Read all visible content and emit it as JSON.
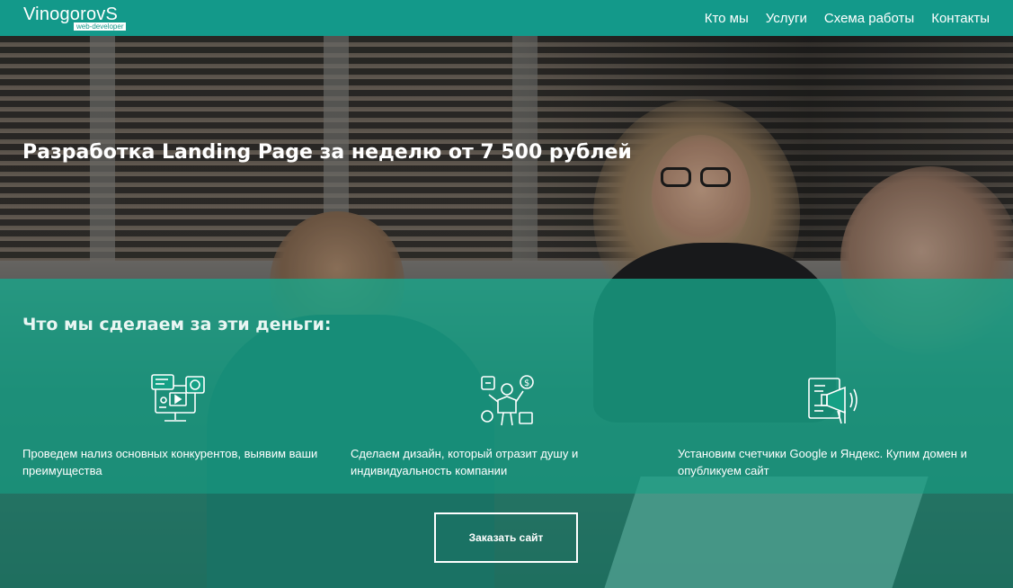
{
  "header": {
    "logo_text": "VinogorovS",
    "logo_subtitle": "web-developer",
    "nav": [
      "Кто мы",
      "Услуги",
      "Схема работы",
      "Контакты"
    ]
  },
  "hero": {
    "title": "Разработка Landing Page за неделю от 7 500 рублей"
  },
  "features": {
    "title": "Что мы сделаем за эти деньги:",
    "items": [
      {
        "icon": "analytics-monitor-icon",
        "text": "Проведем нализ основных конкурентов, выявим ваши преимущества"
      },
      {
        "icon": "designer-icon",
        "text": "Сделаем дизайн, который отразит душу и индивидуальность компании"
      },
      {
        "icon": "megaphone-icon",
        "text": "Установим счетчики Google и Яндекс. Купим домен и опубликуем сайт"
      }
    ]
  },
  "cta": {
    "label": "Заказать сайт"
  },
  "colors": {
    "header": "#13998a",
    "panel": "#16a085",
    "text": "#ffffff"
  }
}
